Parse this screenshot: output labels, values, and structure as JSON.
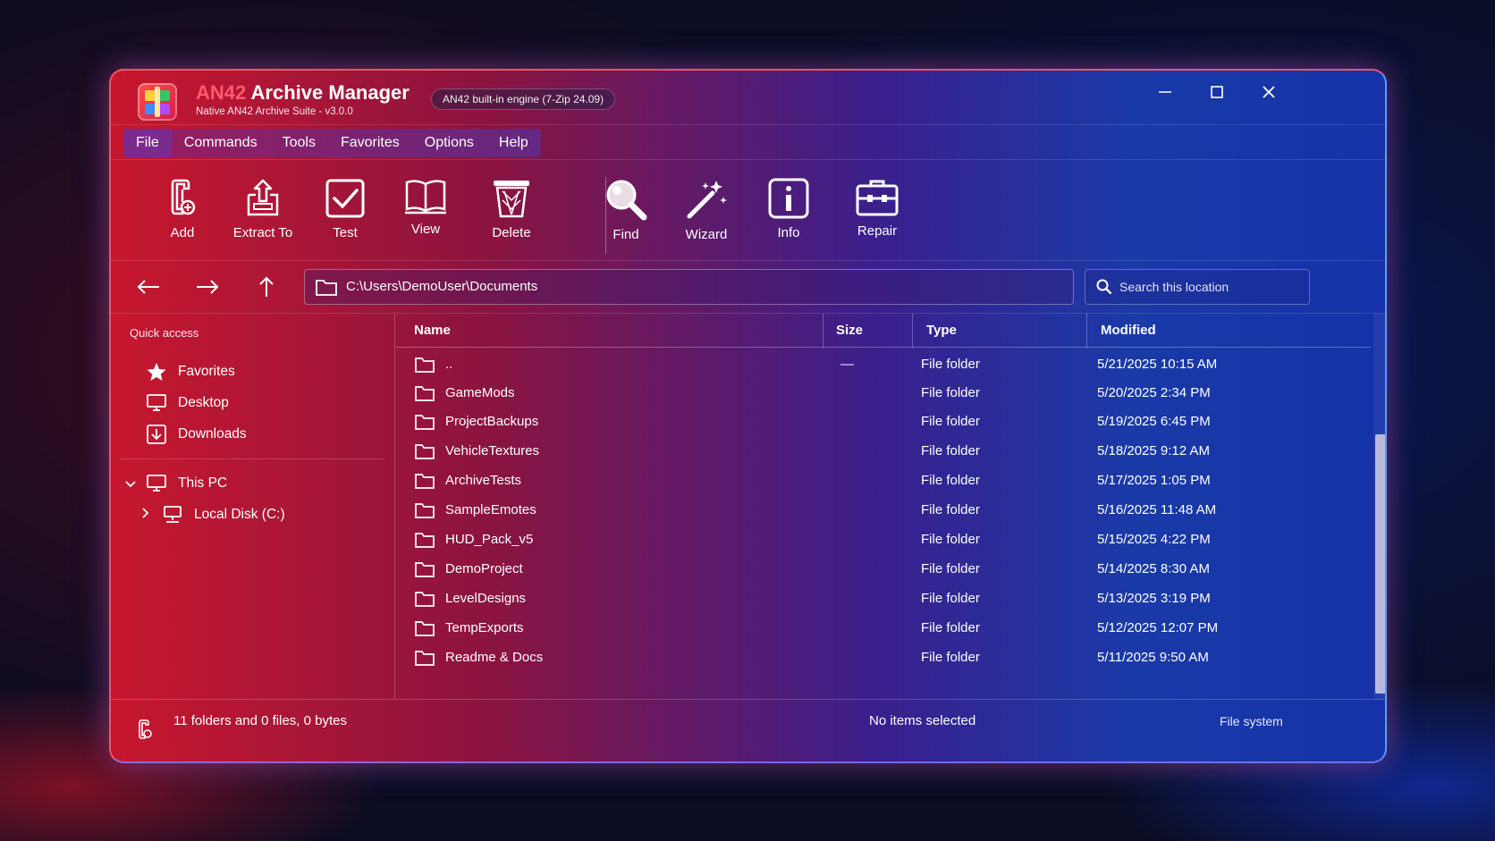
{
  "window": {
    "title_accent": "AN42",
    "title_rest": " Archive Manager",
    "subtitle": "Native AN42 Archive Suite - v3.0.0",
    "engine_badge": "AN42 built-in engine (7-Zip 24.09)"
  },
  "menu": [
    "File",
    "Commands",
    "Tools",
    "Favorites",
    "Options",
    "Help"
  ],
  "toolbar": {
    "add": "Add",
    "extract": "Extract To",
    "test": "Test",
    "view": "View",
    "delete": "Delete",
    "find": "Find",
    "wizard": "Wizard",
    "info": "Info",
    "repair": "Repair"
  },
  "nav": {
    "path": "C:\\Users\\DemoUser\\Documents",
    "search_placeholder": "Search this location"
  },
  "sidebar": {
    "heading": "Quick access",
    "quick": [
      "Favorites",
      "Desktop",
      "Downloads"
    ],
    "this_pc": "This PC",
    "local_disk": "Local Disk (C:)"
  },
  "columns": {
    "name": "Name",
    "size": "Size",
    "type": "Type",
    "modified": "Modified"
  },
  "files": [
    {
      "name": "..",
      "size": "—",
      "type": "File folder",
      "modified": "5/21/2025 10:15 AM"
    },
    {
      "name": "GameMods",
      "size": "",
      "type": "File folder",
      "modified": "5/20/2025 2:34 PM"
    },
    {
      "name": "ProjectBackups",
      "size": "",
      "type": "File folder",
      "modified": "5/19/2025 6:45 PM"
    },
    {
      "name": "VehicleTextures",
      "size": "",
      "type": "File folder",
      "modified": "5/18/2025 9:12 AM"
    },
    {
      "name": "ArchiveTests",
      "size": "",
      "type": "File folder",
      "modified": "5/17/2025 1:05 PM"
    },
    {
      "name": "SampleEmotes",
      "size": "",
      "type": "File folder",
      "modified": "5/16/2025 11:48 AM"
    },
    {
      "name": "HUD_Pack_v5",
      "size": "",
      "type": "File folder",
      "modified": "5/15/2025 4:22 PM"
    },
    {
      "name": "DemoProject",
      "size": "",
      "type": "File folder",
      "modified": "5/14/2025 8:30 AM"
    },
    {
      "name": "LevelDesigns",
      "size": "",
      "type": "File folder",
      "modified": "5/13/2025 3:19 PM"
    },
    {
      "name": "TempExports",
      "size": "",
      "type": "File folder",
      "modified": "5/12/2025 12:07 PM"
    },
    {
      "name": "Readme & Docs",
      "size": "",
      "type": "File folder",
      "modified": "5/11/2025 9:50 AM"
    }
  ],
  "status": {
    "summary": "11 folders and 0 files, 0 bytes",
    "selection": "No items selected",
    "source": "File system"
  }
}
